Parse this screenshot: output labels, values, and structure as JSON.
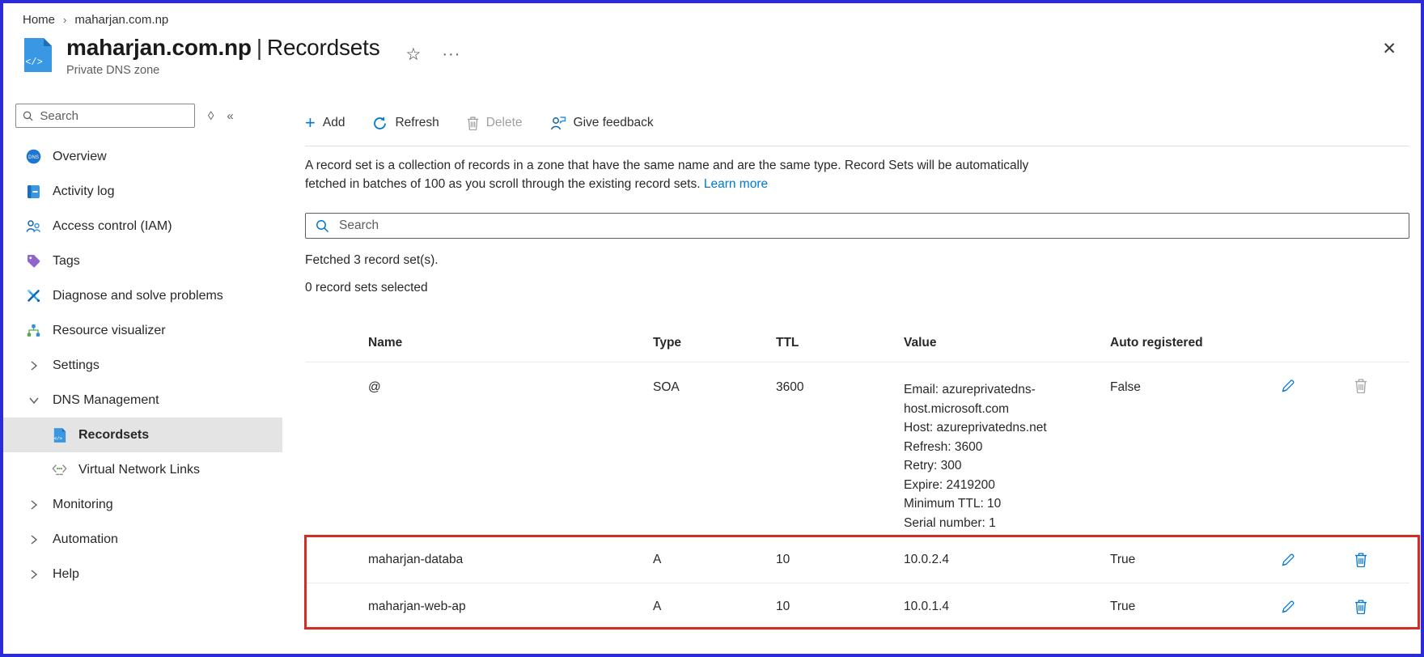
{
  "breadcrumb": {
    "home": "Home",
    "separator": "›",
    "current": "maharjan.com.np"
  },
  "header": {
    "title_name": "maharjan.com.np",
    "title_separator": "|",
    "title_section": "Recordsets",
    "subtitle": "Private DNS zone",
    "star_icon": "☆",
    "more_icon": "···",
    "close_icon": "✕"
  },
  "sidebar": {
    "search_placeholder": "Search",
    "sort_glyph": "◊",
    "collapse_glyph": "«",
    "items": [
      {
        "label": "Overview"
      },
      {
        "label": "Activity log"
      },
      {
        "label": "Access control (IAM)"
      },
      {
        "label": "Tags"
      },
      {
        "label": "Diagnose and solve problems"
      },
      {
        "label": "Resource visualizer"
      },
      {
        "label": "Settings"
      },
      {
        "label": "DNS Management"
      },
      {
        "label": "Recordsets"
      },
      {
        "label": "Virtual Network Links"
      },
      {
        "label": "Monitoring"
      },
      {
        "label": "Automation"
      },
      {
        "label": "Help"
      }
    ]
  },
  "toolbar": {
    "add_label": "Add",
    "refresh_label": "Refresh",
    "delete_label": "Delete",
    "feedback_label": "Give feedback"
  },
  "description": {
    "text": "A record set is a collection of records in a zone that have the same name and are the same type. Record Sets will be automatically fetched in batches of 100 as you scroll through the existing record sets.",
    "link_label": "Learn more"
  },
  "search": {
    "placeholder": "Search"
  },
  "status": {
    "fetched": "Fetched 3 record set(s).",
    "selected": "0 record sets selected"
  },
  "table": {
    "columns": {
      "name": "Name",
      "type": "Type",
      "ttl": "TTL",
      "value": "Value",
      "auto": "Auto registered"
    },
    "rows": [
      {
        "name": "@",
        "type": "SOA",
        "ttl": "3600",
        "value": "Email: azureprivatedns-\nhost.microsoft.com\nHost: azureprivatedns.net\nRefresh: 3600\nRetry: 300\nExpire: 2419200\nMinimum TTL: 10\nSerial number: 1",
        "auto_registered": "False",
        "delete_enabled": false
      },
      {
        "name": "maharjan-databa",
        "type": "A",
        "ttl": "10",
        "value": "10.0.2.4",
        "auto_registered": "True",
        "delete_enabled": true
      },
      {
        "name": "maharjan-web-ap",
        "type": "A",
        "ttl": "10",
        "value": "10.0.1.4",
        "auto_registered": "True",
        "delete_enabled": true
      }
    ]
  },
  "colors": {
    "accent_blue": "#0078d4",
    "outer_border_blue": "#2b2bd9",
    "highlight_red": "#d22d23",
    "disabled_gray": "#a19f9d"
  }
}
